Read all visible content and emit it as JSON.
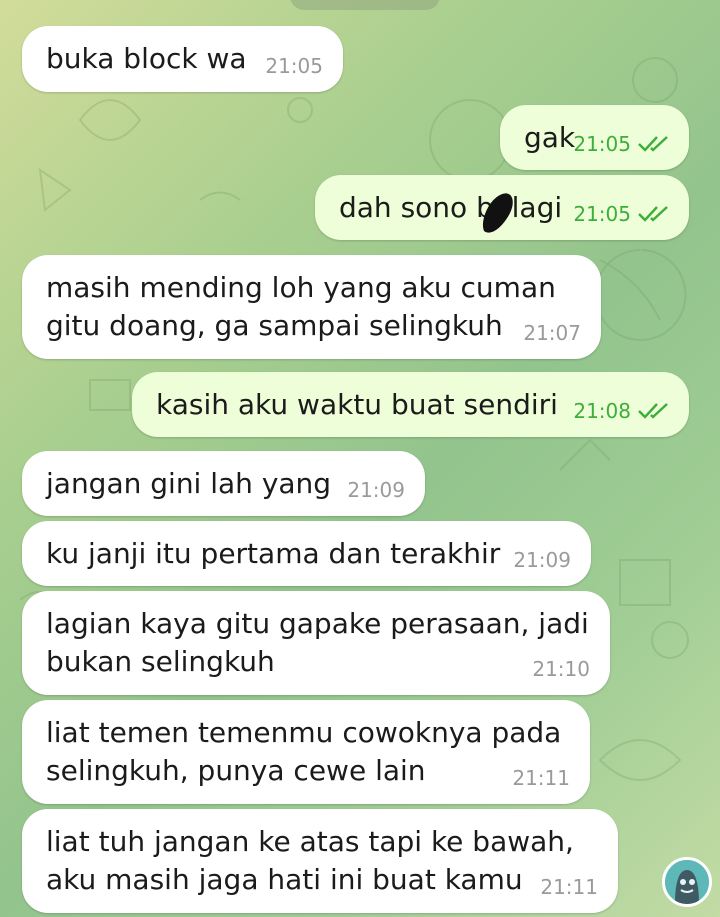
{
  "messages": [
    {
      "id": "m1",
      "direction": "incoming",
      "text": "buka block wa",
      "time": "21:05"
    },
    {
      "id": "m2",
      "direction": "outgoing",
      "text": "gak",
      "time": "21:05",
      "status": "read"
    },
    {
      "id": "m3",
      "direction": "outgoing",
      "text": "dah sono b  lagi",
      "time": "21:05",
      "status": "read"
    },
    {
      "id": "m4",
      "direction": "incoming",
      "text": "masih mending loh yang aku cuman\ngitu doang, ga sampai selingkuh",
      "time": "21:07"
    },
    {
      "id": "m5",
      "direction": "outgoing",
      "text": "kasih aku waktu buat sendiri",
      "time": "21:08",
      "status": "read"
    },
    {
      "id": "m6",
      "direction": "incoming",
      "text": "jangan gini lah yang",
      "time": "21:09"
    },
    {
      "id": "m7",
      "direction": "incoming",
      "text": "ku janji itu pertama dan terakhir",
      "time": "21:09"
    },
    {
      "id": "m8",
      "direction": "incoming",
      "text": "lagian kaya gitu gapake perasaan, jadi\nbukan selingkuh",
      "time": "21:10"
    },
    {
      "id": "m9",
      "direction": "incoming",
      "text": "liat temen temenmu cowoknya pada\nselingkuh, punya cewe lain",
      "time": "21:11"
    },
    {
      "id": "m10",
      "direction": "incoming",
      "text": "liat tuh jangan ke atas tapi ke bawah,\naku masih jaga hati ini buat kamu",
      "time": "21:11"
    }
  ],
  "icons": {
    "read_receipt": "double-check-icon",
    "redaction": "scribble-redaction",
    "avatar": "user-avatar"
  },
  "colors": {
    "incoming_bubble": "#ffffff",
    "outgoing_bubble": "#eefed8",
    "outgoing_time": "#3dae3a",
    "incoming_time": "#9a9a9a"
  }
}
